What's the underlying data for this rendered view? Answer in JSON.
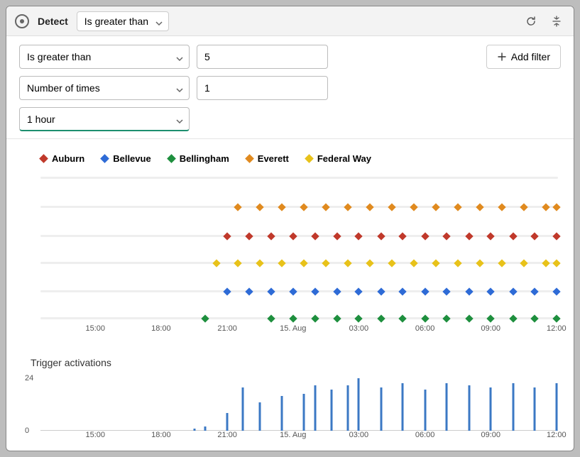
{
  "header": {
    "title": "Detect",
    "mode": "Is greater than"
  },
  "controls": {
    "operator": "Is greater than",
    "threshold": "5",
    "count_label": "Number of times",
    "count_value": "1",
    "window": "1 hour",
    "add_filter": "Add filter"
  },
  "legend": [
    {
      "name": "Auburn",
      "color": "#c0392b"
    },
    {
      "name": "Bellevue",
      "color": "#2e6bd6"
    },
    {
      "name": "Bellingham",
      "color": "#1e8f3e"
    },
    {
      "name": "Everett",
      "color": "#e08a1f"
    },
    {
      "name": "Federal Way",
      "color": "#e8c21a"
    }
  ],
  "x_ticks": [
    "15:00",
    "18:00",
    "21:00",
    "15. Aug",
    "03:00",
    "06:00",
    "09:00",
    "12:00"
  ],
  "x_tick_positions": [
    11.1,
    24.4,
    37.8,
    51.1,
    64.4,
    77.8,
    91.1,
    104.4
  ],
  "bars_title": "Trigger activations",
  "bars_y_ticks": [
    "24",
    "0"
  ],
  "chart_data": {
    "type": "scatter",
    "xlabel": "",
    "ylabel": "",
    "x_start": "14. Aug 12:30",
    "x_end": "15. Aug 12:00",
    "series_row_pct": {
      "Everett": 20.5,
      "Auburn": 40,
      "Federal Way": 58,
      "Bellevue": 77,
      "Bellingham": 95
    },
    "series": [
      {
        "name": "Everett",
        "color": "#e08a1f",
        "x_pct": [
          40,
          44.4,
          48.9,
          53.3,
          57.8,
          62.2,
          66.7,
          71.1,
          75.6,
          80,
          84.4,
          88.9,
          93.3,
          97.8,
          102.2,
          104.4
        ]
      },
      {
        "name": "Auburn",
        "color": "#c0392b",
        "x_pct": [
          37.8,
          42.2,
          46.7,
          51.1,
          55.6,
          60,
          64.4,
          68.9,
          73.3,
          77.8,
          82.2,
          86.7,
          91.1,
          95.6,
          100,
          104.4
        ]
      },
      {
        "name": "Federal Way",
        "color": "#e8c21a",
        "x_pct": [
          35.6,
          40,
          44.4,
          48.9,
          53.3,
          57.8,
          62.2,
          66.7,
          71.1,
          75.6,
          80,
          84.4,
          88.9,
          93.3,
          97.8,
          102.2,
          104.4
        ]
      },
      {
        "name": "Bellevue",
        "color": "#2e6bd6",
        "x_pct": [
          37.8,
          42.2,
          46.7,
          51.1,
          55.6,
          60,
          64.4,
          68.9,
          73.3,
          77.8,
          82.2,
          86.7,
          91.1,
          95.6,
          100,
          104.4
        ]
      },
      {
        "name": "Bellingham",
        "color": "#1e8f3e",
        "x_pct": [
          33.3,
          46.7,
          51.1,
          55.6,
          60,
          64.4,
          68.9,
          73.3,
          77.8,
          82.2,
          86.7,
          91.1,
          95.6,
          100,
          104.4
        ]
      }
    ],
    "bars": {
      "type": "bar",
      "title": "Trigger activations",
      "ylim": [
        0,
        24
      ],
      "points": [
        {
          "x_pct": 31.1,
          "v": 1
        },
        {
          "x_pct": 33.3,
          "v": 2
        },
        {
          "x_pct": 37.8,
          "v": 8
        },
        {
          "x_pct": 41,
          "v": 20
        },
        {
          "x_pct": 44.4,
          "v": 13
        },
        {
          "x_pct": 48.9,
          "v": 16
        },
        {
          "x_pct": 53.3,
          "v": 17
        },
        {
          "x_pct": 55.6,
          "v": 21
        },
        {
          "x_pct": 58.9,
          "v": 19
        },
        {
          "x_pct": 62.2,
          "v": 21
        },
        {
          "x_pct": 64.4,
          "v": 24
        },
        {
          "x_pct": 68.9,
          "v": 20
        },
        {
          "x_pct": 73.3,
          "v": 22
        },
        {
          "x_pct": 77.8,
          "v": 19
        },
        {
          "x_pct": 82.2,
          "v": 22
        },
        {
          "x_pct": 86.7,
          "v": 21
        },
        {
          "x_pct": 91.1,
          "v": 20
        },
        {
          "x_pct": 95.6,
          "v": 22
        },
        {
          "x_pct": 100,
          "v": 20
        },
        {
          "x_pct": 104.4,
          "v": 22
        }
      ]
    }
  }
}
